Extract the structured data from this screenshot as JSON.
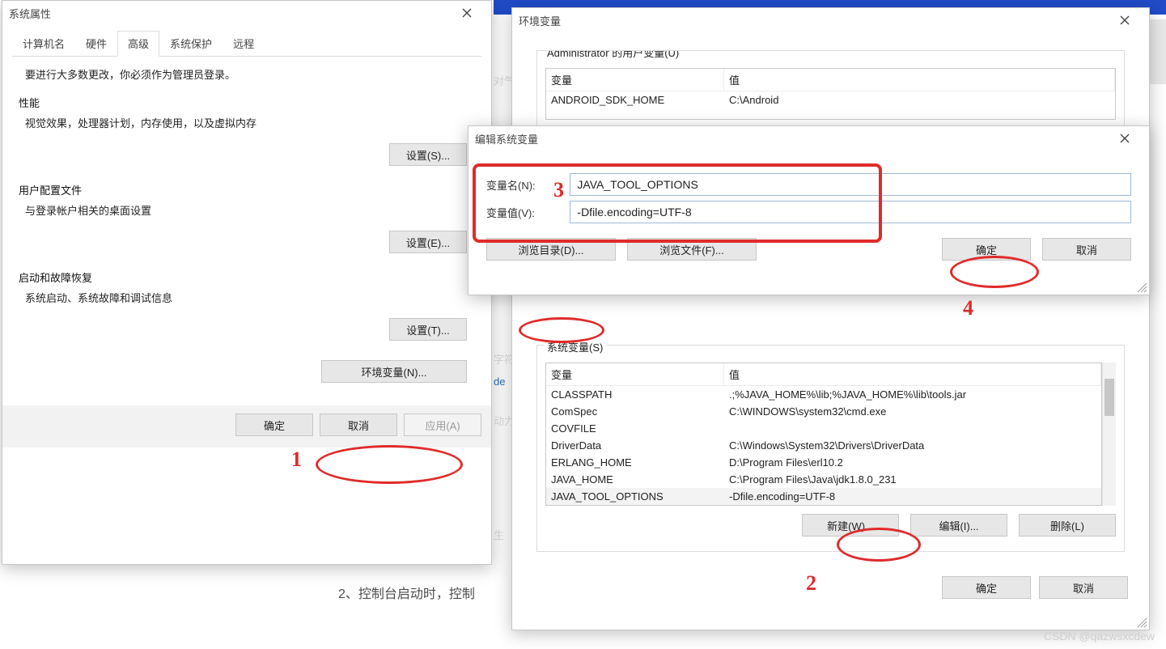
{
  "bg": {
    "text1": "对气",
    "text2": "字符",
    "text3": "de",
    "text4": "动力",
    "text5": "生",
    "below_text": "2、控制台启动时，控制"
  },
  "sysprops": {
    "title": "系统属性",
    "tabs": {
      "computer": "计算机名",
      "hardware": "硬件",
      "advanced": "高级",
      "protection": "系统保护",
      "remote": "远程"
    },
    "admin_note": "要进行大多数更改，你必须作为管理员登录。",
    "perf": {
      "title": "性能",
      "desc": "视觉效果，处理器计划，内存使用，以及虚拟内存",
      "btn": "设置(S)..."
    },
    "userprof": {
      "title": "用户配置文件",
      "desc": "与登录帐户相关的桌面设置",
      "btn": "设置(E)..."
    },
    "startup": {
      "title": "启动和故障恢复",
      "desc": "系统启动、系统故障和调试信息",
      "btn": "设置(T)..."
    },
    "envbtn": "环境变量(N)...",
    "ok": "确定",
    "cancel": "取消",
    "apply": "应用(A)"
  },
  "envvars": {
    "title": "环境变量",
    "user_title": "Administrator 的用户变量(U)",
    "cols": {
      "var": "变量",
      "val": "值"
    },
    "user_rows": [
      {
        "name": "ANDROID_SDK_HOME",
        "val": "C:\\Android"
      }
    ],
    "sys_title": "系统变量(S)",
    "sys_rows": [
      {
        "name": "CLASSPATH",
        "val": ".;%JAVA_HOME%\\lib;%JAVA_HOME%\\lib\\tools.jar"
      },
      {
        "name": "ComSpec",
        "val": "C:\\WINDOWS\\system32\\cmd.exe"
      },
      {
        "name": "COVFILE",
        "val": ""
      },
      {
        "name": "DriverData",
        "val": "C:\\Windows\\System32\\Drivers\\DriverData"
      },
      {
        "name": "ERLANG_HOME",
        "val": "D:\\Program Files\\erl10.2"
      },
      {
        "name": "JAVA_HOME",
        "val": "C:\\Program Files\\Java\\jdk1.8.0_231"
      },
      {
        "name": "JAVA_TOOL_OPTIONS",
        "val": "-Dfile.encoding=UTF-8"
      }
    ],
    "new": "新建(W)...",
    "edit": "编辑(I)...",
    "del": "删除(L)",
    "ok": "确定",
    "cancel": "取消"
  },
  "editvar": {
    "title": "编辑系统变量",
    "lbl_name": "变量名(N):",
    "lbl_val": "变量值(V):",
    "val_name": "JAVA_TOOL_OPTIONS",
    "val_val": "-Dfile.encoding=UTF-8",
    "browse_dir": "浏览目录(D)...",
    "browse_file": "浏览文件(F)...",
    "ok": "确定",
    "cancel": "取消"
  },
  "annots": {
    "n1": "1",
    "n2": "2",
    "n3": "3",
    "n4": "4"
  },
  "watermark": "CSDN @qazwsxcdew"
}
